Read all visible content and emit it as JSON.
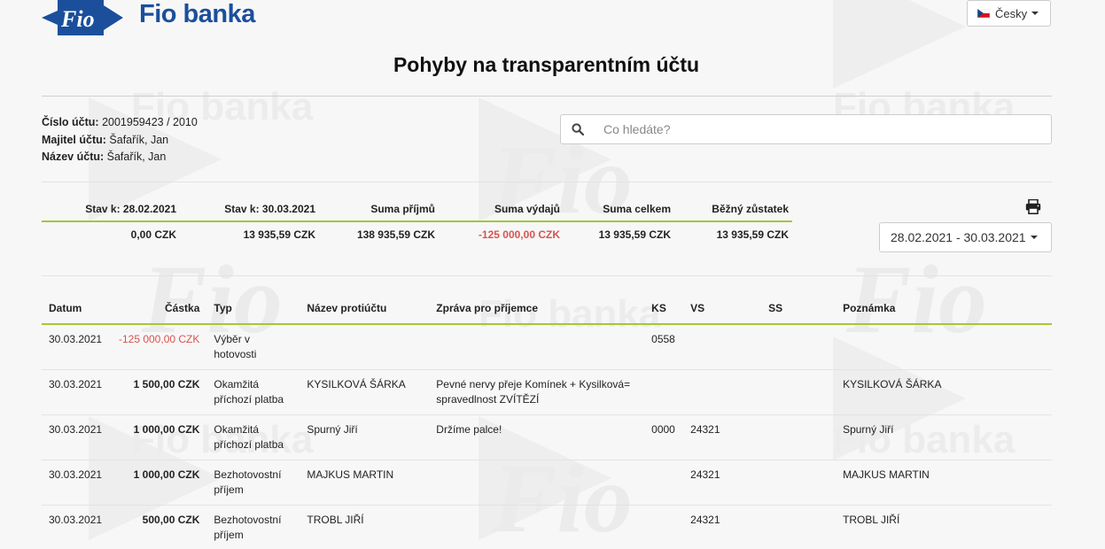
{
  "header": {
    "brand": "Fio banka",
    "logo_text": "Fio",
    "language": "Česky",
    "title": "Pohyby na transparentním účtu"
  },
  "account": {
    "number_label": "Číslo účtu:",
    "number": "2001959423 / 2010",
    "owner_label": "Majitel účtu:",
    "owner": "Šafařík, Jan",
    "name_label": "Název účtu:",
    "name": "Šafařík, Jan"
  },
  "search": {
    "placeholder": "Co hledáte?"
  },
  "summary": {
    "headers": [
      "Stav k: 28.02.2021",
      "Stav k: 30.03.2021",
      "Suma příjmů",
      "Suma výdajů",
      "Suma celkem",
      "Běžný zůstatek"
    ],
    "values": [
      "0,00 CZK",
      "13 935,59 CZK",
      "138 935,59 CZK",
      "-125 000,00 CZK",
      "13 935,59 CZK",
      "13 935,59 CZK"
    ]
  },
  "date_range": "28.02.2021 - 30.03.2021",
  "table": {
    "columns": [
      "Datum",
      "Částka",
      "Typ",
      "Název protiúčtu",
      "Zpráva pro příjemce",
      "KS",
      "VS",
      "SS",
      "Poznámka"
    ],
    "rows": [
      {
        "date": "30.03.2021",
        "amount": "-125 000,00 CZK",
        "type": "Výběr v hotovosti",
        "counterparty": "",
        "message": "",
        "ks": "0558",
        "vs": "",
        "ss": "",
        "note": ""
      },
      {
        "date": "30.03.2021",
        "amount": "1 500,00 CZK",
        "type": "Okamžitá příchozí platba",
        "counterparty": "KYSILKOVÁ ŠÁRKA",
        "message": "Pevné nervy přeje Komínek + Kysilková= spravedlnost ZVÍTĚZÍ",
        "ks": "",
        "vs": "",
        "ss": "",
        "note": "KYSILKOVÁ ŠÁRKA"
      },
      {
        "date": "30.03.2021",
        "amount": "1 000,00 CZK",
        "type": "Okamžitá příchozí platba",
        "counterparty": "Spurný Jiří",
        "message": "Držíme palce!",
        "ks": "0000",
        "vs": "24321",
        "ss": "",
        "note": "Spurný Jiří"
      },
      {
        "date": "30.03.2021",
        "amount": "1 000,00 CZK",
        "type": "Bezhotovostní příjem",
        "counterparty": "MAJKUS MARTIN",
        "message": "",
        "ks": "",
        "vs": "24321",
        "ss": "",
        "note": "MAJKUS MARTIN"
      },
      {
        "date": "30.03.2021",
        "amount": "500,00 CZK",
        "type": "Bezhotovostní příjem",
        "counterparty": "TROBL JIŘÍ",
        "message": "",
        "ks": "",
        "vs": "24321",
        "ss": "",
        "note": "TROBL JIŘÍ"
      }
    ]
  },
  "colors": {
    "brand": "#1b4f9c",
    "accent_line": "#a4c639",
    "negative": "#d9534f"
  },
  "icons": {
    "search": "search-icon",
    "print": "print-icon",
    "flag": "czech-flag-icon"
  }
}
